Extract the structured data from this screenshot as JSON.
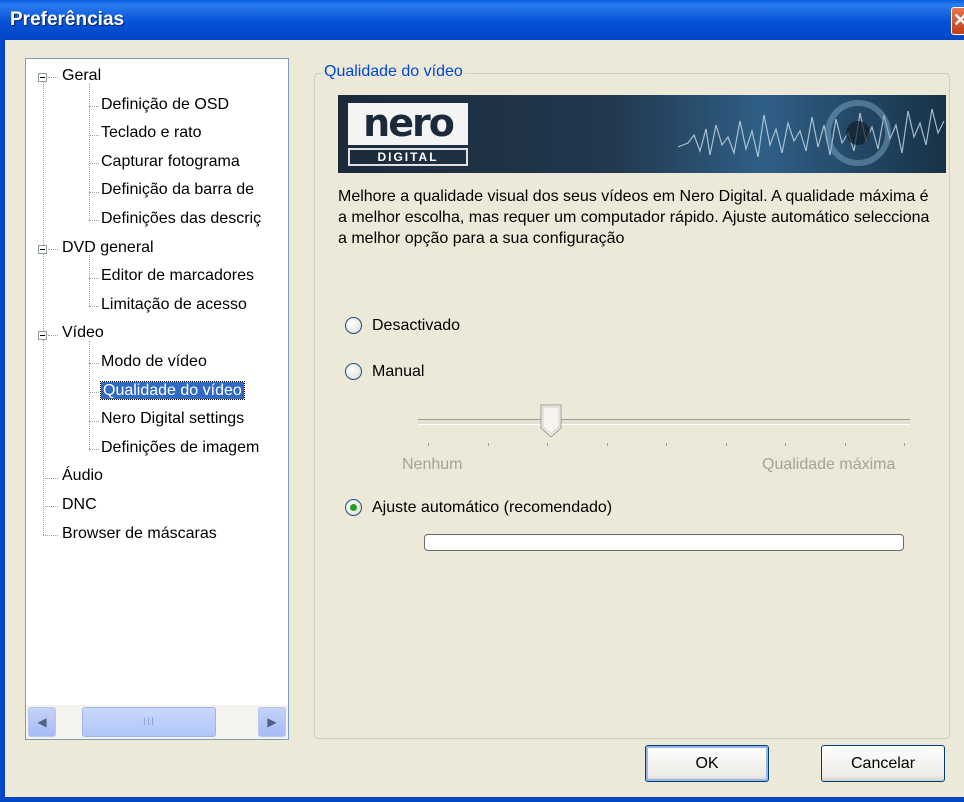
{
  "window": {
    "title": "Preferências",
    "close_glyph": "✕"
  },
  "tree": {
    "items": [
      {
        "label": "Geral",
        "level": 0,
        "expanded": true
      },
      {
        "label": "Definição de OSD",
        "level": 1
      },
      {
        "label": "Teclado e rato",
        "level": 1
      },
      {
        "label": "Capturar fotograma",
        "level": 1
      },
      {
        "label": "Definição da barra de",
        "level": 1
      },
      {
        "label": "Definições das descriç",
        "level": 1
      },
      {
        "label": "DVD general",
        "level": 0,
        "expanded": true
      },
      {
        "label": "Editor de marcadores",
        "level": 1
      },
      {
        "label": "Limitação de acesso",
        "level": 1
      },
      {
        "label": "Vídeo",
        "level": 0,
        "expanded": true
      },
      {
        "label": "Modo de vídeo",
        "level": 1
      },
      {
        "label": "Qualidade do vídeo",
        "level": 1,
        "selected": true
      },
      {
        "label": "Nero Digital settings",
        "level": 1
      },
      {
        "label": "Definições de imagem",
        "level": 1
      },
      {
        "label": "Áudio",
        "level": 0
      },
      {
        "label": "DNC",
        "level": 0
      },
      {
        "label": "Browser de máscaras",
        "level": 0
      }
    ],
    "scroll_left_glyph": "◀",
    "scroll_right_glyph": "▶",
    "thumb_grip": "III"
  },
  "panel": {
    "group_title": "Qualidade do vídeo",
    "logo": {
      "word": "nero",
      "sub": "DIGITAL"
    },
    "description": "Melhore a qualidade visual dos seus vídeos em Nero Digital. A qualidade máxima é a melhor escolha, mas requer um computador rápido. Ajuste automático selecciona a melhor opção para a sua configuração",
    "options": {
      "disabled_label": "Desactivado",
      "manual_label": "Manual",
      "auto_label": "Ajuste automático (recomendado)",
      "selected": "auto"
    },
    "slider": {
      "min_label": "Nenhum",
      "max_label": "Qualidade máxima",
      "value_fraction": 0.25,
      "ticks": 9
    },
    "progress": {
      "value": 0
    }
  },
  "buttons": {
    "ok": "OK",
    "cancel": "Cancelar"
  },
  "colors": {
    "titlebar": "#0552d6",
    "selection": "#316ac5",
    "group_title": "#0046d5"
  }
}
